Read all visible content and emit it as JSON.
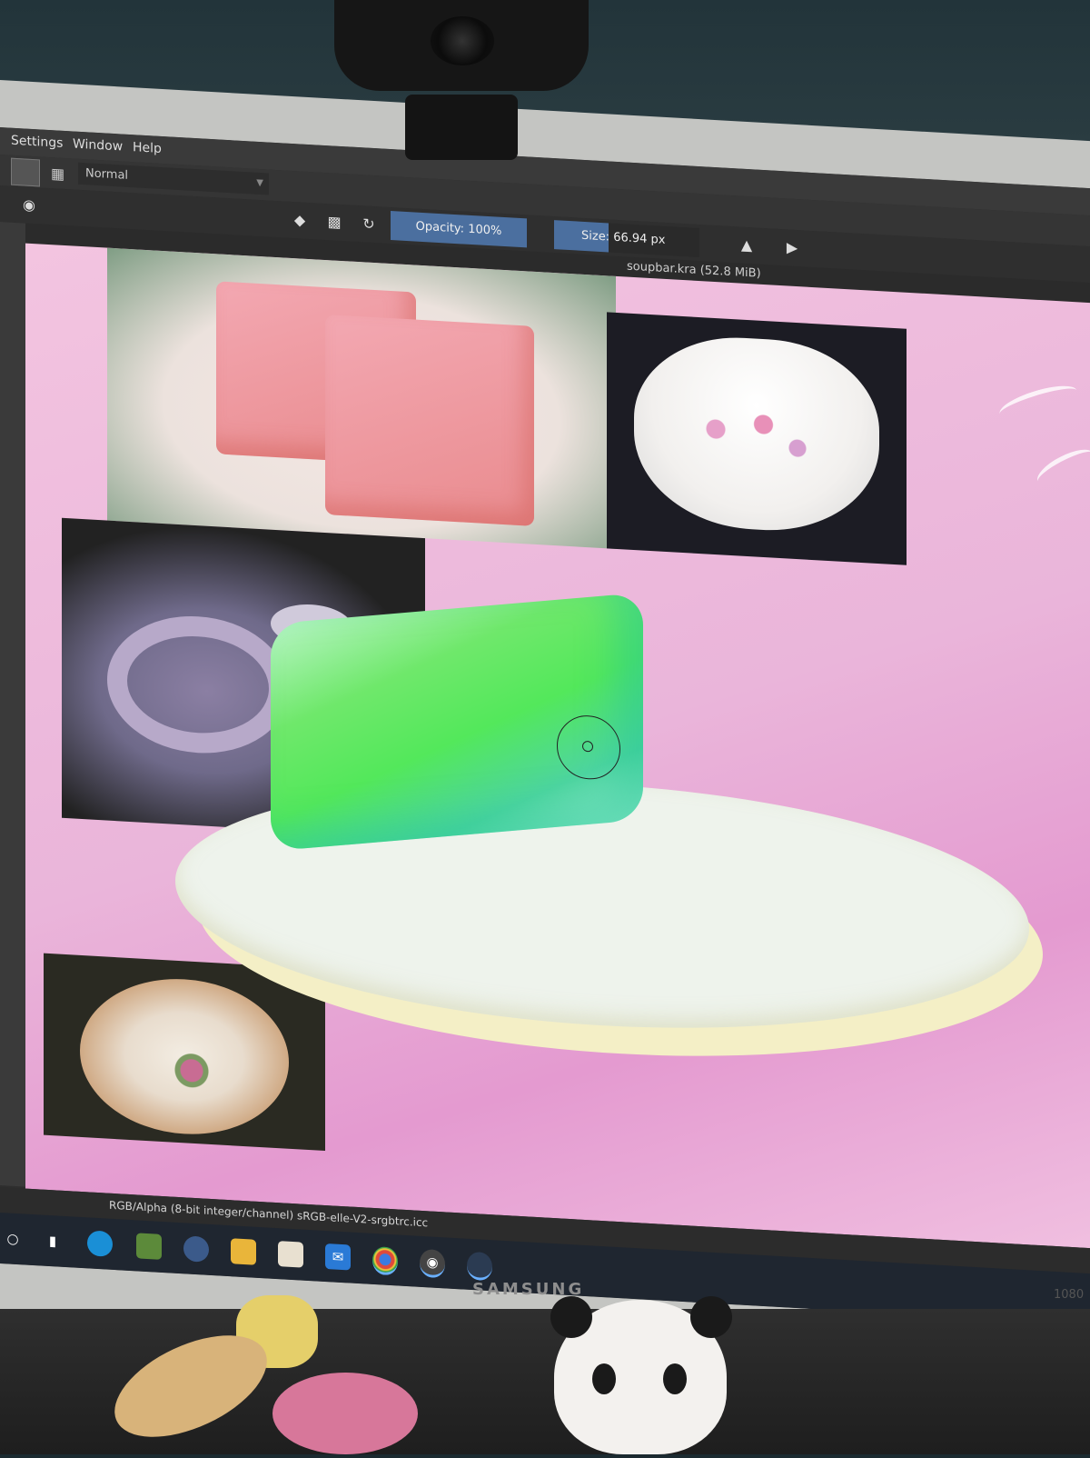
{
  "menu": {
    "items": [
      "Settings",
      "Window",
      "Help"
    ]
  },
  "toolbar": {
    "blend_mode": "Normal"
  },
  "tool_options": {
    "opacity_label": "Opacity:  100%",
    "size_label": "Size: 66.94 px"
  },
  "document": {
    "title": "soupbar.kra (52.8 MiB)"
  },
  "status_bar": {
    "color_profile": "RGB/Alpha (8-bit integer/channel)  sRGB-elle-V2-srgbtrc.icc"
  },
  "monitor": {
    "brand": "SAMSUNG",
    "resolution_label": "1080"
  },
  "colors": {
    "opacity_highlight": "#4b6f9f",
    "canvas_pink": "#eab5da",
    "render_green": "#53e85b"
  },
  "icons": {
    "toolbar": [
      "brush-preset-icon",
      "preset-grid-icon"
    ],
    "options": [
      "eraser-icon",
      "alpha-lock-icon",
      "reload-icon",
      "mirror-horizontal-icon",
      "mirror-vertical-icon"
    ],
    "taskbar": [
      "search-icon",
      "task-view-icon",
      "edge-icon",
      "minecraft-icon",
      "steam-icon",
      "file-explorer-icon",
      "store-icon",
      "mail-icon",
      "chrome-icon",
      "krita-icon",
      "app-icon"
    ]
  }
}
